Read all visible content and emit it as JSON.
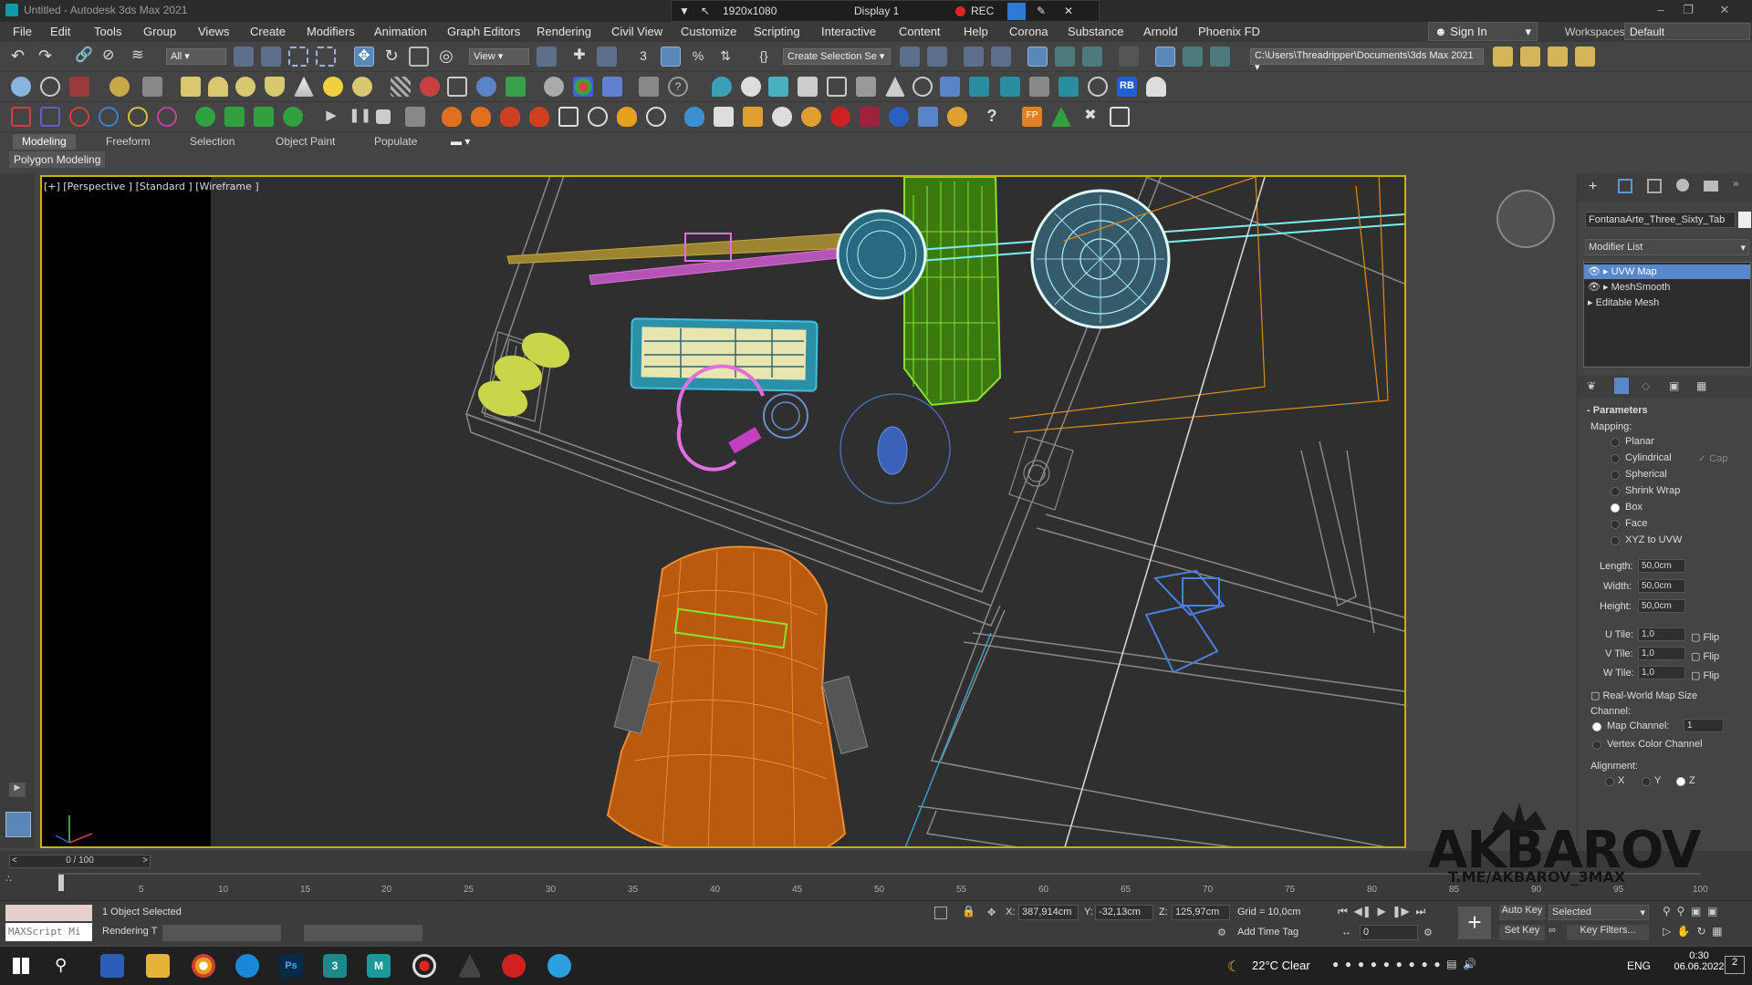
{
  "titlebar": {
    "title": "Untitled - Autodesk 3ds Max 2021"
  },
  "recorder": {
    "resolution": "1920x1080",
    "display": "Display 1",
    "rec": "REC"
  },
  "menu": [
    "File",
    "Edit",
    "Tools",
    "Group",
    "Views",
    "Create",
    "Modifiers",
    "Animation",
    "Graph Editors",
    "Rendering",
    "Civil View",
    "Customize",
    "Scripting",
    "Interactive",
    "Content",
    "Help",
    "Corona",
    "Substance",
    "Arnold",
    "Phoenix FD"
  ],
  "signin": "Sign In",
  "workspace": {
    "label": "Workspaces:",
    "value": "Default"
  },
  "toolbar": {
    "filter": "All",
    "refcoord": "View",
    "selection_set": "Create Selection Se",
    "project_path": "C:\\Users\\Threadripper\\Documents\\3ds Max 2021"
  },
  "ribbon": {
    "tabs": [
      "Modeling",
      "Freeform",
      "Selection",
      "Object Paint",
      "Populate"
    ],
    "sub": "Polygon Modeling"
  },
  "viewport": {
    "label": "[+] [Perspective ] [Standard ] [Wireframe ]"
  },
  "command_panel": {
    "object_name": "FontanaArte_Three_Sixty_Tab",
    "modifier_list": "Modifier List",
    "stack": [
      "UVW Map",
      "MeshSmooth",
      "Editable Mesh"
    ],
    "parameters": "Parameters",
    "mapping_label": "Mapping:",
    "mapping_options": [
      "Planar",
      "Cylindrical",
      "Spherical",
      "Shrink Wrap",
      "Box",
      "Face",
      "XYZ to UVW"
    ],
    "mapping_selected": "Box",
    "cap": "Cap",
    "length_label": "Length:",
    "length": "50,0cm",
    "width_label": "Width:",
    "width": "50,0cm",
    "height_label": "Height:",
    "height": "50,0cm",
    "u_tile_label": "U Tile:",
    "u_tile": "1,0",
    "v_tile_label": "V Tile:",
    "v_tile": "1,0",
    "w_tile_label": "W Tile:",
    "w_tile": "1,0",
    "flip": "Flip",
    "realworld": "Real-World Map Size",
    "channel_label": "Channel:",
    "map_channel": "Map Channel:",
    "map_channel_value": "1",
    "vertex_color": "Vertex Color Channel",
    "alignment": "Alignment:",
    "align_x": "X",
    "align_y": "Y",
    "align_z": "Z"
  },
  "timeline": {
    "frame": "0 / 100",
    "ticks": [
      "5",
      "10",
      "15",
      "20",
      "25",
      "30",
      "35",
      "40",
      "45",
      "50",
      "55",
      "60",
      "65",
      "70",
      "75",
      "80",
      "85",
      "90",
      "95",
      "100"
    ]
  },
  "status": {
    "selected": "1 Object Selected",
    "rendering": "Rendering T",
    "maxscript": "MAXScript Mi",
    "x_label": "X:",
    "x": "387,914cm",
    "y_label": "Y:",
    "y": "-32,13cm",
    "z_label": "Z:",
    "z": "125,97cm",
    "grid": "Grid = 10,0cm",
    "add_time_tag": "Add Time Tag",
    "auto_key": "Auto Key",
    "set_key": "Set Key",
    "selected_dd": "Selected",
    "key_filters": "Key Filters...",
    "frame_field": "0"
  },
  "taskbar": {
    "weather": "22°C  Clear",
    "lang": "ENG",
    "time": "0:30",
    "date": "06.06.2022",
    "notif": "2"
  },
  "watermark": {
    "big": "AKBAROV",
    "small": "T.ME/AKBAROV_3MAX"
  }
}
